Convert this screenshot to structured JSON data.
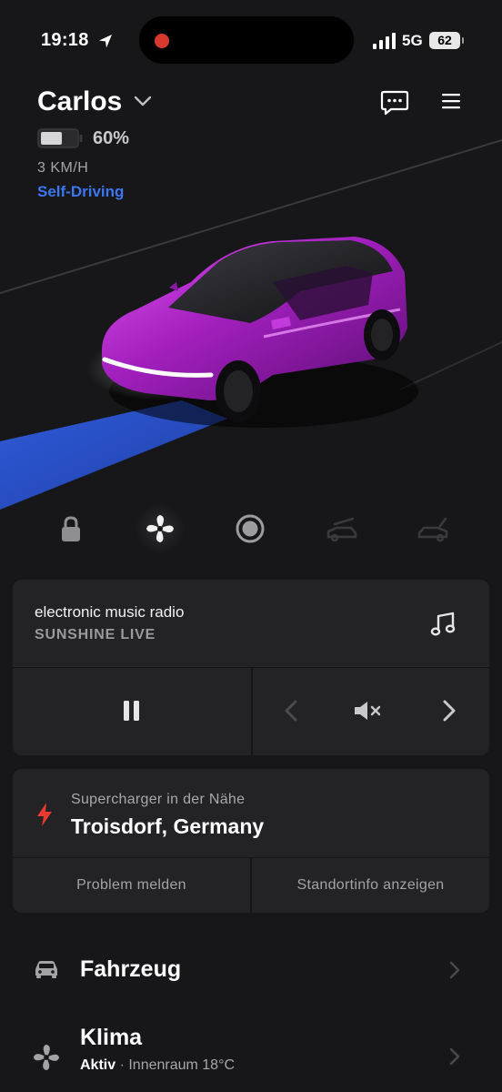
{
  "status_bar": {
    "time": "19:18",
    "network": "5G",
    "battery": "62",
    "recording_dot_color": "#d9382f"
  },
  "header": {
    "vehicle_name": "Carlos",
    "battery_percent": "60%",
    "battery_level": 0.6,
    "speed": "3 KM/H",
    "mode": "Self-Driving",
    "mode_color": "#3b77f0",
    "vehicle_paint_color": "#b52ad0"
  },
  "quick_controls": [
    {
      "icon": "lock-icon",
      "active": false
    },
    {
      "icon": "fan-icon",
      "active": true
    },
    {
      "icon": "record-icon",
      "active": false
    },
    {
      "icon": "frunk-icon",
      "active": false
    },
    {
      "icon": "trunk-icon",
      "active": false
    }
  ],
  "media": {
    "title": "electronic music radio",
    "station": "SUNSHINE LIVE"
  },
  "charger": {
    "label": "Supercharger in der Nähe",
    "location": "Troisdorf, Germany",
    "action_report": "Problem melden",
    "action_info": "Standortinfo anzeigen",
    "bolt_color": "#e8392e"
  },
  "menu_rows": {
    "vehicle": {
      "title": "Fahrzeug"
    },
    "climate": {
      "title": "Klima",
      "status": "Aktiv",
      "detail": " · Innenraum 18°C"
    }
  }
}
